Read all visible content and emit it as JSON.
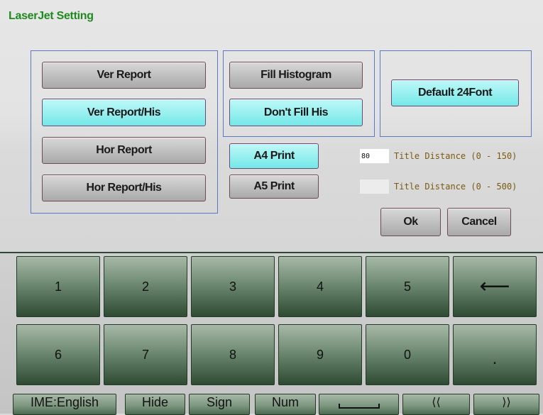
{
  "window": {
    "title": "LaserJet Setting"
  },
  "report_group": {
    "buttons": [
      {
        "label": "Ver Report",
        "selected": false
      },
      {
        "label": "Ver Report/His",
        "selected": true
      },
      {
        "label": "Hor Report",
        "selected": false
      },
      {
        "label": "Hor Report/His",
        "selected": false
      }
    ]
  },
  "histogram_group": {
    "buttons": [
      {
        "label": "Fill Histogram",
        "selected": false
      },
      {
        "label": "Don't Fill His",
        "selected": true
      }
    ]
  },
  "font_group": {
    "label": "Default 24Font",
    "selected": true
  },
  "paper": {
    "a4": {
      "label": "A4 Print",
      "selected": true
    },
    "a5": {
      "label": "A5 Print",
      "selected": false
    }
  },
  "title_distance": {
    "a4": {
      "value": "80",
      "label": "Title Distance (0 - 150)"
    },
    "a5": {
      "value": "",
      "label": "Title Distance (0 - 500)"
    }
  },
  "actions": {
    "ok": "Ok",
    "cancel": "Cancel"
  },
  "keyboard": {
    "row1": [
      "1",
      "2",
      "3",
      "4",
      "5"
    ],
    "row2": [
      "6",
      "7",
      "8",
      "9",
      "0"
    ],
    "backspace_icon": "left-arrow-icon",
    "dot": ".",
    "function_keys": {
      "ime": "IME:English",
      "hide": "Hide",
      "sign": "Sign",
      "num": "Num",
      "space_icon": "space-bar-icon",
      "prev_icon": "double-left-arrow-icon",
      "next_icon": "double-right-arrow-icon"
    }
  },
  "colors": {
    "title": "#1f8a1f",
    "selected_button": "#8ef0f0",
    "group_border": "#5a78c8",
    "key_dark": "#2f4a33",
    "hint_text": "#7a5a12"
  }
}
